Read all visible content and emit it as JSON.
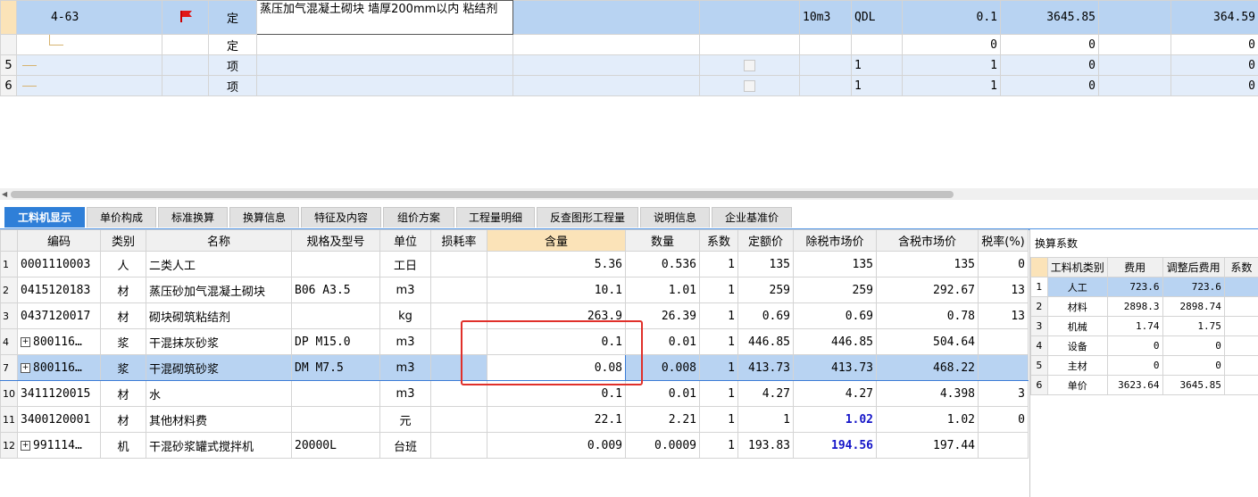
{
  "top_rows": [
    {
      "rowno": "",
      "code": "4-63",
      "type": "定",
      "name": "蒸压加气混凝土砌块 墙厚200mm以内 粘结剂",
      "unit": "10m3",
      "expr": "QDL",
      "qty": "0.1",
      "price": "3645.85",
      "total": "364.59"
    },
    {
      "rowno": "",
      "code": "",
      "type": "定",
      "name": "",
      "unit": "",
      "expr": "",
      "qty": "0",
      "price": "0",
      "total": "0"
    },
    {
      "rowno": "5",
      "code": "",
      "type": "项",
      "name": "",
      "unit": "",
      "expr": "1",
      "qty": "1",
      "price": "0",
      "total": "0"
    },
    {
      "rowno": "6",
      "code": "",
      "type": "项",
      "name": "",
      "unit": "",
      "expr": "1",
      "qty": "1",
      "price": "0",
      "total": "0"
    }
  ],
  "tabs": [
    "工料机显示",
    "单价构成",
    "标准换算",
    "换算信息",
    "特征及内容",
    "组价方案",
    "工程量明细",
    "反查图形工程量",
    "说明信息",
    "企业基准价"
  ],
  "bottom_headers": [
    "编码",
    "类别",
    "名称",
    "规格及型号",
    "单位",
    "损耗率",
    "含量",
    "数量",
    "系数",
    "定额价",
    "除税市场价",
    "含税市场价",
    "税率(%)"
  ],
  "bottom_rows": [
    {
      "no": "1",
      "code": "0001110003",
      "cat": "人",
      "name": "二类人工",
      "spec": "",
      "unit": "工日",
      "loss": "",
      "content": "5.36",
      "qty": "0.536",
      "coef": "1",
      "quota": "135",
      "net": "135",
      "gross": "135",
      "tax": "0"
    },
    {
      "no": "2",
      "code": "0415120183",
      "cat": "材",
      "name": "蒸压砂加气混凝土砌块",
      "spec": "B06 A3.5",
      "unit": "m3",
      "loss": "",
      "content": "10.1",
      "qty": "1.01",
      "coef": "1",
      "quota": "259",
      "net": "259",
      "gross": "292.67",
      "tax": "13"
    },
    {
      "no": "3",
      "code": "0437120017",
      "cat": "材",
      "name": "砌块砌筑粘结剂",
      "spec": "",
      "unit": "kg",
      "loss": "",
      "content": "263.9",
      "qty": "26.39",
      "coef": "1",
      "quota": "0.69",
      "net": "0.69",
      "gross": "0.78",
      "tax": "13"
    },
    {
      "no": "4",
      "code": "800116…",
      "cat": "浆",
      "name": "干混抹灰砂浆",
      "spec": "DP M15.0",
      "unit": "m3",
      "loss": "",
      "content": "0.1",
      "qty": "0.01",
      "coef": "1",
      "quota": "446.85",
      "net": "446.85",
      "gross": "504.64",
      "tax": ""
    },
    {
      "no": "7",
      "code": "800116…",
      "cat": "浆",
      "name": "干混砌筑砂浆",
      "spec": "DM M7.5",
      "unit": "m3",
      "loss": "",
      "content": "0.08",
      "qty": "0.008",
      "coef": "1",
      "quota": "413.73",
      "net": "413.73",
      "gross": "468.22",
      "tax": ""
    },
    {
      "no": "10",
      "code": "3411120015",
      "cat": "材",
      "name": "水",
      "spec": "",
      "unit": "m3",
      "loss": "",
      "content": "0.1",
      "qty": "0.01",
      "coef": "1",
      "quota": "4.27",
      "net": "4.27",
      "gross": "4.398",
      "tax": "3"
    },
    {
      "no": "11",
      "code": "3400120001",
      "cat": "材",
      "name": "其他材料费",
      "spec": "",
      "unit": "元",
      "loss": "",
      "content": "22.1",
      "qty": "2.21",
      "coef": "1",
      "quota": "1",
      "net": "1.02",
      "gross": "1.02",
      "tax": "0"
    },
    {
      "no": "12",
      "code": "991114…",
      "cat": "机",
      "name": "干混砂浆罐式搅拌机",
      "spec": "20000L",
      "unit": "台班",
      "loss": "",
      "content": "0.009",
      "qty": "0.0009",
      "coef": "1",
      "quota": "193.83",
      "net": "194.56",
      "gross": "197.44",
      "tax": ""
    }
  ],
  "side": {
    "title": "换算系数",
    "headers": [
      "工料机类别",
      "费用",
      "调整后费用",
      "系数"
    ],
    "rows": [
      {
        "no": "1",
        "cat": "人工",
        "fee": "723.6",
        "adj": "723.6"
      },
      {
        "no": "2",
        "cat": "材料",
        "fee": "2898.3",
        "adj": "2898.74"
      },
      {
        "no": "3",
        "cat": "机械",
        "fee": "1.74",
        "adj": "1.75"
      },
      {
        "no": "4",
        "cat": "设备",
        "fee": "0",
        "adj": "0"
      },
      {
        "no": "5",
        "cat": "主材",
        "fee": "0",
        "adj": "0"
      },
      {
        "no": "6",
        "cat": "单价",
        "fee": "3623.64",
        "adj": "3645.85"
      }
    ]
  },
  "colors": {
    "accent": "#2f7fd8",
    "selected_row": "#b8d3f2",
    "alt_row": "#e3edfa",
    "highlight_header": "#fbe3b8",
    "annotation": "#e0302a",
    "bold_value": "#1515c8"
  },
  "icons": {
    "flag": "red-flag-icon",
    "expand": "plus-box-icon"
  }
}
